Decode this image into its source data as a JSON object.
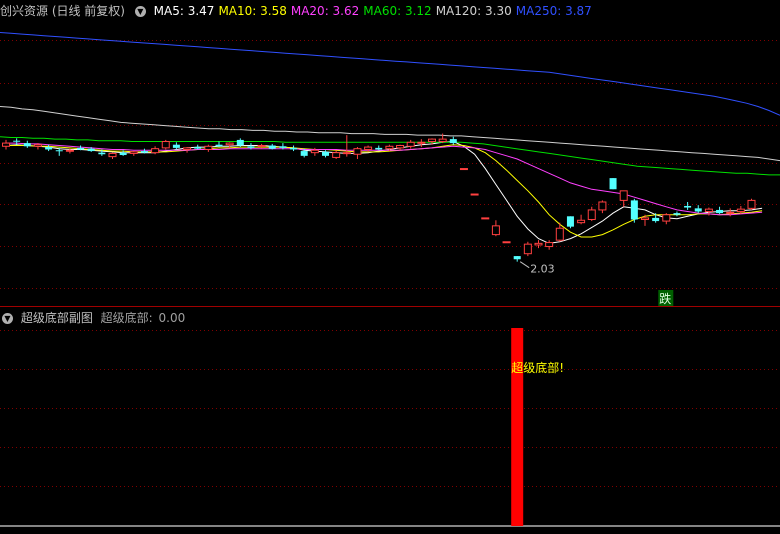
{
  "main_panel": {
    "title": "创兴资源 (日线 前复权)",
    "indicators": [
      {
        "label": "MA5:",
        "value": "3.47",
        "color": "#ffffff"
      },
      {
        "label": "MA10:",
        "value": "3.58",
        "color": "#ffff00"
      },
      {
        "label": "MA20:",
        "value": "3.62",
        "color": "#ff40ff"
      },
      {
        "label": "MA60:",
        "value": "3.12",
        "color": "#00e000"
      },
      {
        "label": "MA120:",
        "value": "3.30",
        "color": "#d0d0d0"
      },
      {
        "label": "MA250:",
        "value": "3.87",
        "color": "#3050ff"
      }
    ],
    "low_annotation": "2.03",
    "signal_label": "跌"
  },
  "sub_panel": {
    "title": "超级底部副图",
    "indicator_label": "超级底部:",
    "indicator_value": "0.00",
    "signal_text": "超级底部!"
  },
  "colors": {
    "up_candle": "#ff4040",
    "down_candle": "#54ffff",
    "grid": "#800000",
    "signal_bar": "#ff0000"
  },
  "candles": [
    {
      "o": 3.48,
      "h": 3.56,
      "l": 3.44,
      "c": 3.52
    },
    {
      "o": 3.55,
      "h": 3.58,
      "l": 3.5,
      "c": 3.54
    },
    {
      "o": 3.52,
      "h": 3.55,
      "l": 3.46,
      "c": 3.48
    },
    {
      "o": 3.48,
      "h": 3.52,
      "l": 3.44,
      "c": 3.5
    },
    {
      "o": 3.47,
      "h": 3.5,
      "l": 3.42,
      "c": 3.44
    },
    {
      "o": 3.43,
      "h": 3.46,
      "l": 3.36,
      "c": 3.42
    },
    {
      "o": 3.42,
      "h": 3.45,
      "l": 3.39,
      "c": 3.43
    },
    {
      "o": 3.46,
      "h": 3.49,
      "l": 3.43,
      "c": 3.44
    },
    {
      "o": 3.45,
      "h": 3.47,
      "l": 3.41,
      "c": 3.42
    },
    {
      "o": 3.4,
      "h": 3.44,
      "l": 3.36,
      "c": 3.38
    },
    {
      "o": 3.35,
      "h": 3.4,
      "l": 3.32,
      "c": 3.39
    },
    {
      "o": 3.4,
      "h": 3.43,
      "l": 3.36,
      "c": 3.37
    },
    {
      "o": 3.39,
      "h": 3.42,
      "l": 3.36,
      "c": 3.41
    },
    {
      "o": 3.42,
      "h": 3.45,
      "l": 3.39,
      "c": 3.4
    },
    {
      "o": 3.4,
      "h": 3.48,
      "l": 3.38,
      "c": 3.45
    },
    {
      "o": 3.46,
      "h": 3.56,
      "l": 3.44,
      "c": 3.54
    },
    {
      "o": 3.5,
      "h": 3.53,
      "l": 3.44,
      "c": 3.46
    },
    {
      "o": 3.44,
      "h": 3.47,
      "l": 3.4,
      "c": 3.46
    },
    {
      "o": 3.47,
      "h": 3.5,
      "l": 3.44,
      "c": 3.45
    },
    {
      "o": 3.44,
      "h": 3.5,
      "l": 3.41,
      "c": 3.48
    },
    {
      "o": 3.5,
      "h": 3.54,
      "l": 3.47,
      "c": 3.48
    },
    {
      "o": 3.5,
      "h": 3.53,
      "l": 3.46,
      "c": 3.52
    },
    {
      "o": 3.56,
      "h": 3.58,
      "l": 3.47,
      "c": 3.49
    },
    {
      "o": 3.48,
      "h": 3.52,
      "l": 3.44,
      "c": 3.46
    },
    {
      "o": 3.48,
      "h": 3.51,
      "l": 3.45,
      "c": 3.49
    },
    {
      "o": 3.49,
      "h": 3.51,
      "l": 3.44,
      "c": 3.45
    },
    {
      "o": 3.48,
      "h": 3.52,
      "l": 3.44,
      "c": 3.46
    },
    {
      "o": 3.46,
      "h": 3.49,
      "l": 3.42,
      "c": 3.44
    },
    {
      "o": 3.42,
      "h": 3.45,
      "l": 3.34,
      "c": 3.36
    },
    {
      "o": 3.4,
      "h": 3.46,
      "l": 3.36,
      "c": 3.43
    },
    {
      "o": 3.41,
      "h": 3.43,
      "l": 3.34,
      "c": 3.36
    },
    {
      "o": 3.34,
      "h": 3.43,
      "l": 3.32,
      "c": 3.4
    },
    {
      "o": 3.39,
      "h": 3.62,
      "l": 3.35,
      "c": 3.4
    },
    {
      "o": 3.38,
      "h": 3.47,
      "l": 3.32,
      "c": 3.45
    },
    {
      "o": 3.44,
      "h": 3.49,
      "l": 3.41,
      "c": 3.47
    },
    {
      "o": 3.46,
      "h": 3.49,
      "l": 3.43,
      "c": 3.44
    },
    {
      "o": 3.45,
      "h": 3.5,
      "l": 3.42,
      "c": 3.48
    },
    {
      "o": 3.46,
      "h": 3.5,
      "l": 3.43,
      "c": 3.49
    },
    {
      "o": 3.48,
      "h": 3.56,
      "l": 3.45,
      "c": 3.53
    },
    {
      "o": 3.52,
      "h": 3.57,
      "l": 3.47,
      "c": 3.53
    },
    {
      "o": 3.54,
      "h": 3.58,
      "l": 3.5,
      "c": 3.57
    },
    {
      "o": 3.54,
      "h": 3.64,
      "l": 3.52,
      "c": 3.57
    },
    {
      "o": 3.57,
      "h": 3.6,
      "l": 3.5,
      "c": 3.52
    },
    {
      "o": 3.2,
      "h": 3.2,
      "l": 3.2,
      "c": 3.2
    },
    {
      "o": 2.88,
      "h": 2.88,
      "l": 2.88,
      "c": 2.88
    },
    {
      "o": 2.58,
      "h": 2.58,
      "l": 2.58,
      "c": 2.58
    },
    {
      "o": 2.37,
      "h": 2.55,
      "l": 2.35,
      "c": 2.48
    },
    {
      "o": 2.28,
      "h": 2.28,
      "l": 2.28,
      "c": 2.28
    },
    {
      "o": 2.1,
      "h": 2.1,
      "l": 2.03,
      "c": 2.06
    },
    {
      "o": 2.13,
      "h": 2.28,
      "l": 2.1,
      "c": 2.25
    },
    {
      "o": 2.24,
      "h": 2.3,
      "l": 2.2,
      "c": 2.26
    },
    {
      "o": 2.22,
      "h": 2.3,
      "l": 2.18,
      "c": 2.27
    },
    {
      "o": 2.3,
      "h": 2.52,
      "l": 2.28,
      "c": 2.45
    },
    {
      "o": 2.6,
      "h": 2.6,
      "l": 2.45,
      "c": 2.47
    },
    {
      "o": 2.52,
      "h": 2.62,
      "l": 2.5,
      "c": 2.55
    },
    {
      "o": 2.56,
      "h": 2.72,
      "l": 2.54,
      "c": 2.68
    },
    {
      "o": 2.68,
      "h": 2.8,
      "l": 2.64,
      "c": 2.78
    },
    {
      "o": 3.08,
      "h": 3.08,
      "l": 2.94,
      "c": 2.94
    },
    {
      "o": 2.8,
      "h": 2.92,
      "l": 2.72,
      "c": 2.92
    },
    {
      "o": 2.8,
      "h": 2.82,
      "l": 2.52,
      "c": 2.56
    },
    {
      "o": 2.56,
      "h": 2.62,
      "l": 2.48,
      "c": 2.58
    },
    {
      "o": 2.58,
      "h": 2.64,
      "l": 2.52,
      "c": 2.54
    },
    {
      "o": 2.54,
      "h": 2.64,
      "l": 2.5,
      "c": 2.62
    },
    {
      "o": 2.64,
      "h": 2.66,
      "l": 2.6,
      "c": 2.62
    },
    {
      "o": 2.73,
      "h": 2.78,
      "l": 2.68,
      "c": 2.71
    },
    {
      "o": 2.7,
      "h": 2.74,
      "l": 2.64,
      "c": 2.66
    },
    {
      "o": 2.66,
      "h": 2.71,
      "l": 2.61,
      "c": 2.69
    },
    {
      "o": 2.68,
      "h": 2.72,
      "l": 2.63,
      "c": 2.64
    },
    {
      "o": 2.64,
      "h": 2.7,
      "l": 2.6,
      "c": 2.65
    },
    {
      "o": 2.66,
      "h": 2.73,
      "l": 2.63,
      "c": 2.69
    },
    {
      "o": 2.7,
      "h": 2.82,
      "l": 2.68,
      "c": 2.8
    }
  ],
  "ma_lines": {
    "ma5": [
      3.49,
      3.5,
      3.49,
      3.48,
      3.47,
      3.45,
      3.44,
      3.44,
      3.43,
      3.42,
      3.41,
      3.4,
      3.4,
      3.4,
      3.4,
      3.42,
      3.44,
      3.46,
      3.47,
      3.47,
      3.48,
      3.48,
      3.49,
      3.49,
      3.49,
      3.48,
      3.47,
      3.46,
      3.43,
      3.42,
      3.41,
      3.4,
      3.39,
      3.39,
      3.4,
      3.42,
      3.44,
      3.46,
      3.48,
      3.5,
      3.51,
      3.53,
      3.54,
      3.48,
      3.38,
      3.2,
      3.0,
      2.8,
      2.6,
      2.44,
      2.32,
      2.26,
      2.28,
      2.32,
      2.38,
      2.46,
      2.54,
      2.64,
      2.72,
      2.7,
      2.68,
      2.62,
      2.58,
      2.57,
      2.6,
      2.63,
      2.65,
      2.66,
      2.67,
      2.67,
      2.68,
      2.7
    ],
    "ma10": [
      3.49,
      3.49,
      3.49,
      3.48,
      3.48,
      3.47,
      3.46,
      3.45,
      3.44,
      3.43,
      3.42,
      3.42,
      3.41,
      3.41,
      3.41,
      3.41,
      3.42,
      3.43,
      3.44,
      3.45,
      3.46,
      3.46,
      3.47,
      3.47,
      3.47,
      3.47,
      3.47,
      3.46,
      3.45,
      3.44,
      3.44,
      3.43,
      3.42,
      3.41,
      3.41,
      3.41,
      3.42,
      3.43,
      3.44,
      3.45,
      3.46,
      3.48,
      3.5,
      3.49,
      3.46,
      3.4,
      3.3,
      3.18,
      3.05,
      2.92,
      2.78,
      2.62,
      2.5,
      2.4,
      2.34,
      2.34,
      2.37,
      2.43,
      2.5,
      2.56,
      2.6,
      2.62,
      2.62,
      2.62,
      2.62,
      2.63,
      2.63,
      2.62,
      2.63,
      2.64,
      2.65,
      2.67
    ],
    "ma20": [
      3.52,
      3.52,
      3.51,
      3.51,
      3.5,
      3.49,
      3.48,
      3.47,
      3.46,
      3.45,
      3.44,
      3.44,
      3.43,
      3.43,
      3.43,
      3.43,
      3.43,
      3.43,
      3.44,
      3.44,
      3.44,
      3.45,
      3.45,
      3.45,
      3.45,
      3.45,
      3.45,
      3.45,
      3.44,
      3.44,
      3.44,
      3.44,
      3.43,
      3.43,
      3.43,
      3.43,
      3.43,
      3.43,
      3.44,
      3.45,
      3.46,
      3.47,
      3.48,
      3.47,
      3.46,
      3.44,
      3.4,
      3.36,
      3.32,
      3.26,
      3.2,
      3.14,
      3.08,
      3.02,
      2.98,
      2.94,
      2.92,
      2.9,
      2.88,
      2.84,
      2.8,
      2.76,
      2.72,
      2.68,
      2.66,
      2.64,
      2.63,
      2.62,
      2.62,
      2.63,
      2.64,
      2.65
    ],
    "ma60": [
      3.6,
      3.59,
      3.59,
      3.58,
      3.58,
      3.57,
      3.57,
      3.56,
      3.56,
      3.55,
      3.55,
      3.55,
      3.54,
      3.54,
      3.54,
      3.54,
      3.54,
      3.54,
      3.54,
      3.54,
      3.54,
      3.54,
      3.54,
      3.54,
      3.54,
      3.54,
      3.53,
      3.53,
      3.53,
      3.53,
      3.53,
      3.53,
      3.53,
      3.53,
      3.53,
      3.53,
      3.53,
      3.53,
      3.53,
      3.53,
      3.53,
      3.53,
      3.53,
      3.52,
      3.51,
      3.49,
      3.47,
      3.45,
      3.43,
      3.41,
      3.39,
      3.37,
      3.35,
      3.33,
      3.31,
      3.29,
      3.27,
      3.25,
      3.23,
      3.22,
      3.21,
      3.2,
      3.19,
      3.18,
      3.17,
      3.16,
      3.15,
      3.14,
      3.14,
      3.13,
      3.12,
      3.12
    ],
    "ma120": [
      3.98,
      3.97,
      3.95,
      3.94,
      3.92,
      3.9,
      3.88,
      3.86,
      3.84,
      3.82,
      3.8,
      3.78,
      3.77,
      3.76,
      3.75,
      3.74,
      3.73,
      3.72,
      3.71,
      3.7,
      3.7,
      3.69,
      3.69,
      3.68,
      3.68,
      3.67,
      3.67,
      3.66,
      3.66,
      3.65,
      3.65,
      3.65,
      3.64,
      3.64,
      3.64,
      3.63,
      3.63,
      3.63,
      3.62,
      3.62,
      3.62,
      3.61,
      3.61,
      3.6,
      3.59,
      3.58,
      3.57,
      3.56,
      3.55,
      3.54,
      3.53,
      3.52,
      3.51,
      3.5,
      3.49,
      3.48,
      3.47,
      3.46,
      3.45,
      3.44,
      3.43,
      3.42,
      3.41,
      3.4,
      3.39,
      3.38,
      3.37,
      3.36,
      3.35,
      3.34,
      3.32,
      3.3
    ],
    "ma250": [
      4.91,
      4.9,
      4.89,
      4.88,
      4.87,
      4.86,
      4.85,
      4.84,
      4.83,
      4.82,
      4.81,
      4.8,
      4.79,
      4.78,
      4.77,
      4.76,
      4.75,
      4.74,
      4.73,
      4.72,
      4.71,
      4.7,
      4.69,
      4.68,
      4.67,
      4.66,
      4.65,
      4.64,
      4.63,
      4.62,
      4.61,
      4.6,
      4.59,
      4.58,
      4.57,
      4.56,
      4.55,
      4.54,
      4.53,
      4.52,
      4.51,
      4.5,
      4.49,
      4.48,
      4.47,
      4.46,
      4.45,
      4.44,
      4.43,
      4.42,
      4.41,
      4.39,
      4.37,
      4.35,
      4.33,
      4.31,
      4.29,
      4.27,
      4.25,
      4.23,
      4.21,
      4.19,
      4.17,
      4.15,
      4.13,
      4.11,
      4.08,
      4.05,
      4.02,
      3.98,
      3.93,
      3.87
    ]
  },
  "signal_index": 48,
  "signal_value": 1
}
